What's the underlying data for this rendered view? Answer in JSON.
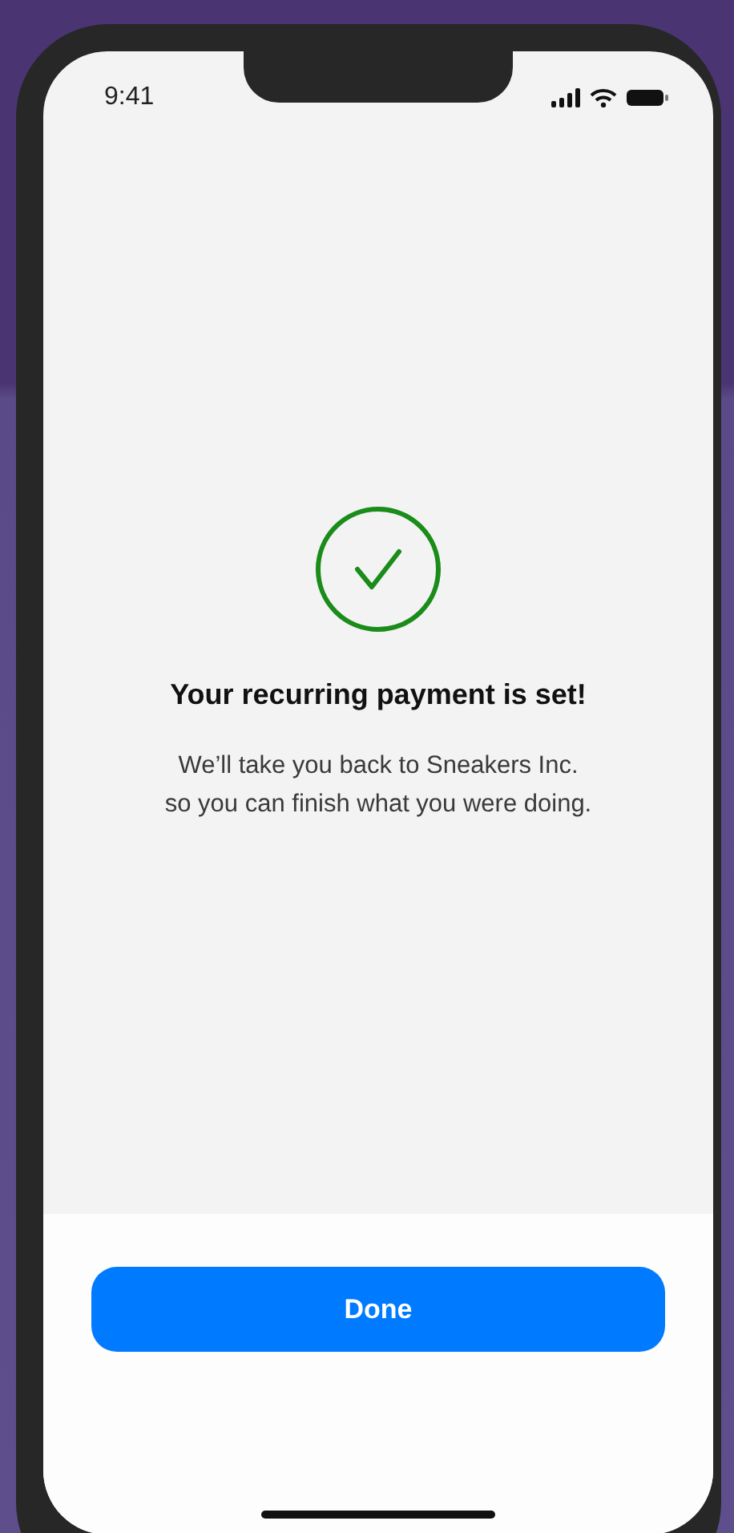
{
  "status_bar": {
    "time": "9:41"
  },
  "confirmation": {
    "title": "Your recurring payment is set!",
    "message": "We’ll take you back to Sneakers Inc.\nso you can finish what you were doing."
  },
  "footer": {
    "button": "Done"
  }
}
